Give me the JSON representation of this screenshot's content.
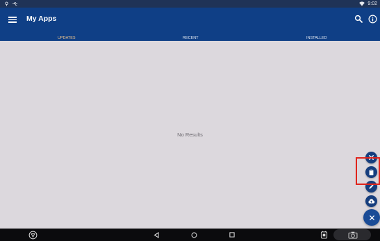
{
  "status_bar": {
    "time": "9:02",
    "icons": [
      "android-debug-icon",
      "usb-icon",
      "wifi-icon"
    ]
  },
  "app_bar": {
    "title": "My Apps",
    "icons": [
      "menu-icon",
      "search-icon",
      "info-icon"
    ]
  },
  "tabs": [
    {
      "label": "UPDATES",
      "active": true
    },
    {
      "label": "RECENT",
      "active": false
    },
    {
      "label": "INSTALLED",
      "active": false
    }
  ],
  "content": {
    "empty_message": "No Results"
  },
  "fab_menu": {
    "items": [
      "close-icon",
      "clipboard-icon",
      "pencil-icon",
      "cloud-upload-icon"
    ],
    "main": "close-icon"
  },
  "nav_bar": {
    "icons": [
      "vpn-key-icon",
      "back-icon",
      "home-icon",
      "recents-icon",
      "screenshot-icon",
      "camera-icon"
    ]
  },
  "colors": {
    "app_bar": "#0f3f86",
    "status_bar": "#1f3357",
    "accent": "#e3a75a",
    "background": "#dcd8dd",
    "fab": "#163e7e",
    "highlight": "#e0241b"
  }
}
